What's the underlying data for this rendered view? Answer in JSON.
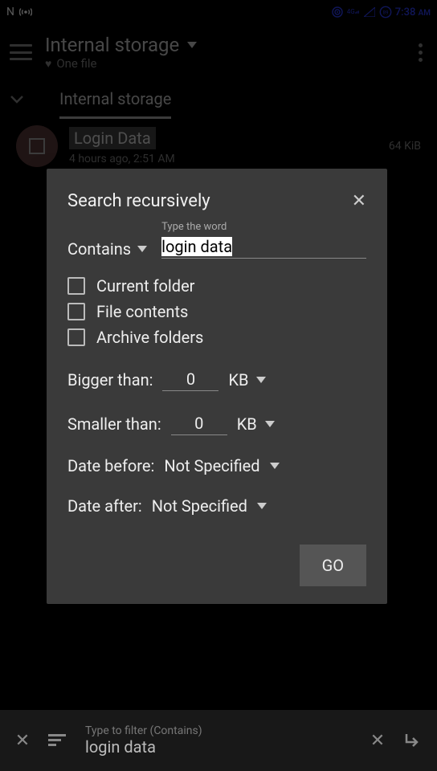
{
  "statusbar": {
    "left_letter": "N",
    "time": "7:38",
    "ampm": "AM"
  },
  "header": {
    "title": "Internal storage",
    "subtitle": "One file"
  },
  "breadcrumb": {
    "current": "Internal storage"
  },
  "file": {
    "name": "Login Data",
    "meta": "4 hours ago, 2:51 AM",
    "size": "64 KiB"
  },
  "dialog": {
    "title": "Search recursively",
    "match_mode": "Contains",
    "input_label": "Type the word",
    "input_value": "login data",
    "opt_current": "Current folder",
    "opt_contents": "File contents",
    "opt_archive": "Archive folders",
    "bigger_label": "Bigger than:",
    "bigger_value": "0",
    "bigger_unit": "KB",
    "smaller_label": "Smaller than:",
    "smaller_value": "0",
    "smaller_unit": "KB",
    "date_before_label": "Date before:",
    "date_before_value": "Not Specified",
    "date_after_label": "Date after:",
    "date_after_value": "Not Specified",
    "go": "GO"
  },
  "bottombar": {
    "hint": "Type to filter (Contains)",
    "value": "login data"
  }
}
